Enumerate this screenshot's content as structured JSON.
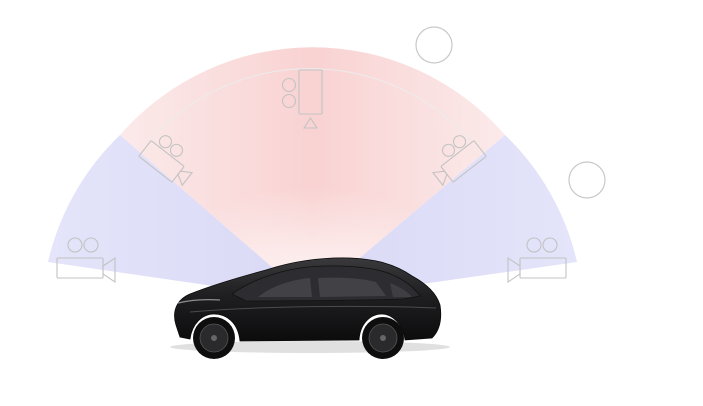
{
  "scene": {
    "background": "#ffffff",
    "colors": {
      "front_sector": "#fbd9d9",
      "side_sector": "#dfdff8",
      "icon_stroke": "#c8c8c8",
      "arc_line": "#e6e6e6",
      "car_body": "#1b1b1c",
      "car_window": "#3c3c40",
      "wheel": "#111112"
    },
    "icons": [
      "camera-icon-front",
      "camera-icon-left-upper",
      "camera-icon-right-upper",
      "camera-icon-left-lower",
      "camera-icon-right-lower",
      "sensor-circle-icon-top",
      "sensor-circle-icon-right"
    ],
    "vehicle": "sedan-car-image"
  }
}
